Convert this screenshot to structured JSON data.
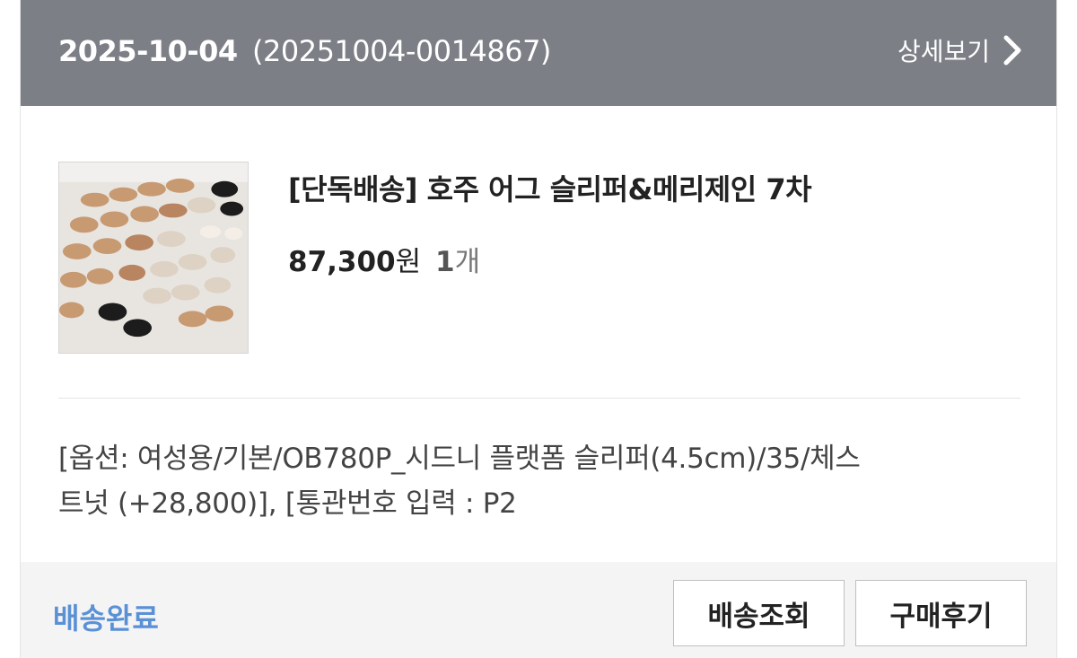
{
  "header": {
    "order_date": "2025-10-04",
    "order_number": "(20251004-0014867)",
    "detail_label": "상세보기",
    "background_color": "#7c7f86"
  },
  "product": {
    "name": "[단독배송] 호주 어그 슬리퍼&메리제인 7차",
    "price": "87,300",
    "price_unit": "원",
    "quantity": "1",
    "quantity_unit": "개"
  },
  "option": {
    "line1": "[옵션: 여성용/기본/OB780P_시드니 플랫폼 슬리퍼(4.5cm)/35/체스",
    "line2": "트넛 (+28,800)], [통관번호 입력 : P2",
    "line2_tail": "]"
  },
  "footer": {
    "status": "배송완료",
    "status_color": "#5a91d6",
    "track_button": "배송조회",
    "review_button": "구매후기"
  },
  "icons": {
    "detail": "chevron-right-icon",
    "thumbnail": "product-photo-slippers"
  }
}
